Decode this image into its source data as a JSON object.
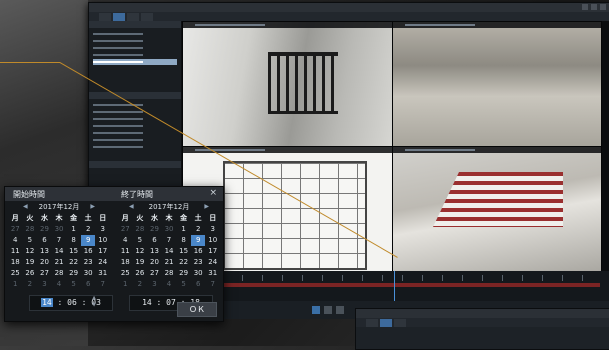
{
  "dialog": {
    "start_title": "開始時間",
    "end_title": "終了時間",
    "ok_label": "ＯＫ",
    "close_label": "×",
    "prev_arrow": "◀",
    "next_arrow": "▶"
  },
  "start_calendar": {
    "month": "2017年12月",
    "weekdays": [
      "月",
      "火",
      "水",
      "木",
      "金",
      "土",
      "日"
    ],
    "rows": [
      [
        "27",
        "28",
        "29",
        "30",
        "1",
        "2",
        "3"
      ],
      [
        "4",
        "5",
        "6",
        "7",
        "8",
        "9",
        "10"
      ],
      [
        "11",
        "12",
        "13",
        "14",
        "15",
        "16",
        "17"
      ],
      [
        "18",
        "19",
        "20",
        "21",
        "22",
        "23",
        "24"
      ],
      [
        "25",
        "26",
        "27",
        "28",
        "29",
        "30",
        "31"
      ],
      [
        "1",
        "2",
        "3",
        "4",
        "5",
        "6",
        "7"
      ]
    ],
    "selected_day": "9",
    "time_hour": "14",
    "time_rest": " : 06 : 03"
  },
  "end_calendar": {
    "month": "2017年12月",
    "weekdays": [
      "月",
      "火",
      "水",
      "木",
      "金",
      "土",
      "日"
    ],
    "rows": [
      [
        "27",
        "28",
        "29",
        "30",
        "1",
        "2",
        "3"
      ],
      [
        "4",
        "5",
        "6",
        "7",
        "8",
        "9",
        "10"
      ],
      [
        "11",
        "12",
        "13",
        "14",
        "15",
        "16",
        "17"
      ],
      [
        "18",
        "19",
        "20",
        "21",
        "22",
        "23",
        "24"
      ],
      [
        "25",
        "26",
        "27",
        "28",
        "29",
        "30",
        "31"
      ],
      [
        "1",
        "2",
        "3",
        "4",
        "5",
        "6",
        "7"
      ]
    ],
    "selected_day": "9",
    "time": "14 : 07 : 18"
  }
}
